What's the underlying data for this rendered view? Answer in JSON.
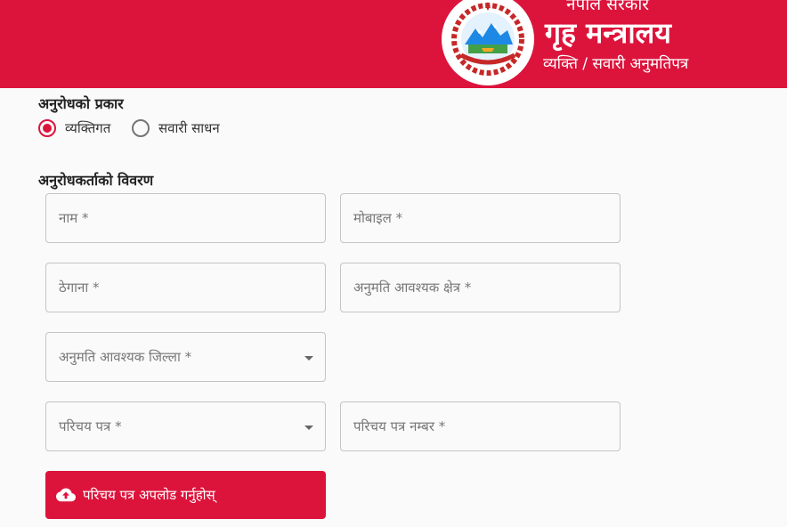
{
  "header": {
    "government": "नेपाल सरकार",
    "ministry": "गृह मन्त्रालय",
    "subtitle": "व्यक्ति / सवारी अनुमतिपत्र",
    "emblem_icon": "nepal-emblem-icon",
    "background_color": "#dc143c"
  },
  "request_type": {
    "title": "अनुरोधको प्रकार",
    "options": [
      {
        "label": "व्यक्तिगत",
        "selected": true
      },
      {
        "label": "सवारी साधन",
        "selected": false
      }
    ]
  },
  "applicant": {
    "title": "अनुरोधकर्ताको विवरण",
    "fields": {
      "name": {
        "placeholder": "नाम *",
        "value": ""
      },
      "mobile": {
        "placeholder": "मोबाइल *",
        "value": ""
      },
      "address": {
        "placeholder": "ठेगाना *",
        "value": ""
      },
      "permit_area": {
        "placeholder": "अनुमति आवश्यक क्षेत्र *",
        "value": ""
      },
      "permit_district": {
        "placeholder": "अनुमति आवश्यक जिल्ला *",
        "value": ""
      },
      "id_card": {
        "placeholder": "परिचय पत्र *",
        "value": ""
      },
      "id_number": {
        "placeholder": "परिचय पत्र नम्बर *",
        "value": ""
      }
    },
    "upload_button": {
      "label": "परिचय पत्र अपलोड गर्नुहोस्",
      "icon": "cloud-upload-icon"
    }
  },
  "colors": {
    "accent": "#dc143c",
    "border": "#c4c4c4",
    "placeholder": "#777777"
  }
}
